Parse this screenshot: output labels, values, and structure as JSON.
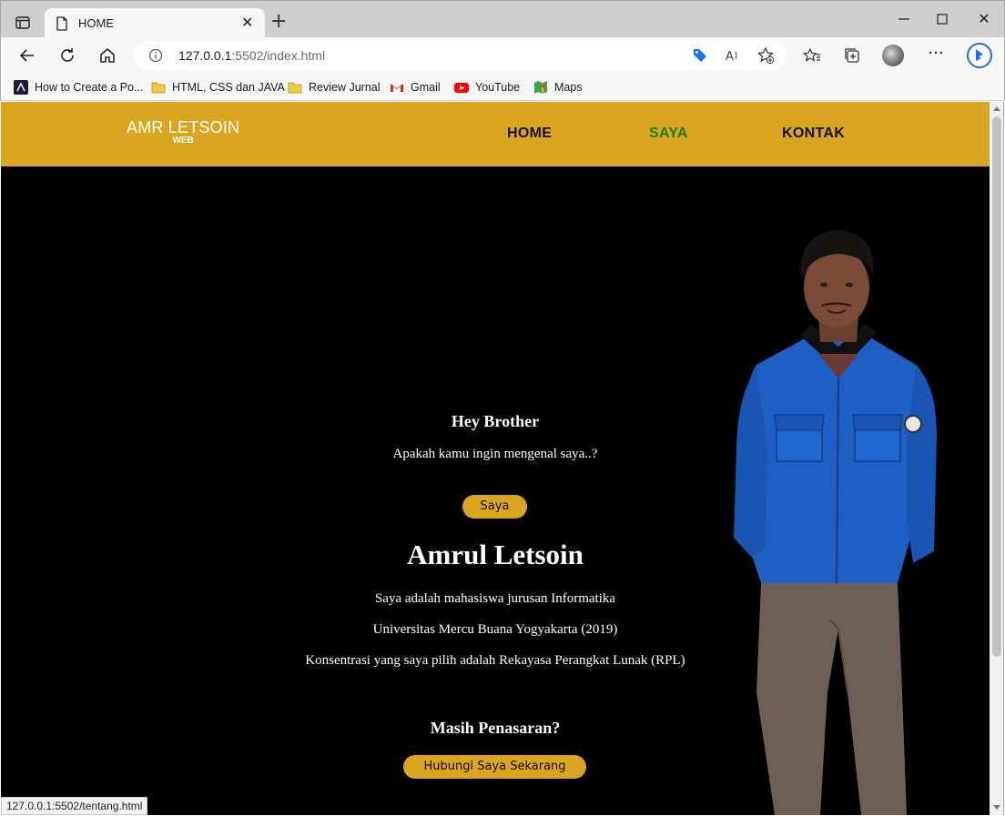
{
  "browser": {
    "tab_title": "HOME",
    "url_host": "127.0.0.1",
    "url_rest": ":5502/index.html",
    "bookmarks": [
      {
        "label": "How to Create a Po...",
        "icon": "site-favicon"
      },
      {
        "label": "HTML, CSS dan JAVA",
        "icon": "folder-icon"
      },
      {
        "label": "Review Jurnal",
        "icon": "folder-icon"
      },
      {
        "label": "Gmail",
        "icon": "gmail-icon"
      },
      {
        "label": "YouTube",
        "icon": "youtube-icon"
      },
      {
        "label": "Maps",
        "icon": "maps-icon"
      }
    ],
    "status_url": "127.0.0.1:5502/tentang.html"
  },
  "site": {
    "logo_main": "AMR LETSOIN",
    "logo_sub": "WEB",
    "nav": [
      {
        "label": "HOME",
        "active": false
      },
      {
        "label": "SAYA",
        "active": true
      },
      {
        "label": "KONTAK",
        "active": false
      }
    ],
    "colors": {
      "accent": "#daa520",
      "active_link": "#1e7d10",
      "background": "#000000"
    }
  },
  "hero": {
    "greeting": "Hey Brother",
    "question": "Apakah kamu ingin mengenal saya..?",
    "saya_button": "Saya",
    "name": "Amrul Letsoin",
    "line1": "Saya adalah mahasiswa jurusan Informatika",
    "line2": "Universitas Mercu Buana Yogyakarta (2019)",
    "line3": "Konsentrasi yang saya pilih adalah Rekayasa Perangkat Lunak (RPL)",
    "curious": "Masih Penasaran?",
    "contact_button": "Hubungi Saya Sekarang"
  }
}
